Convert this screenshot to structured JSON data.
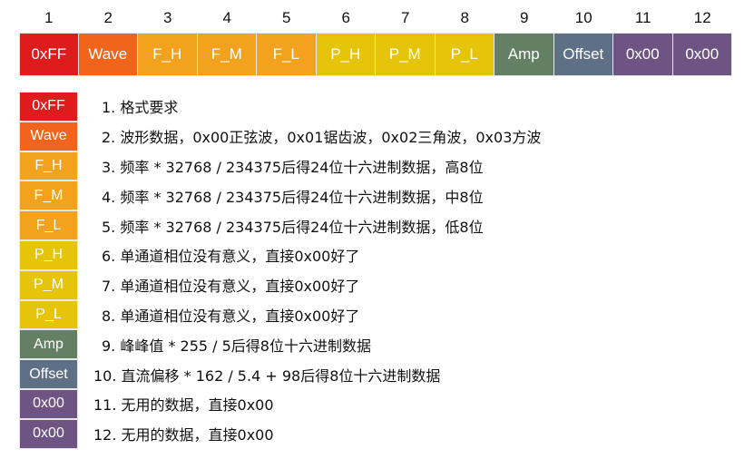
{
  "index_labels": [
    "1",
    "2",
    "3",
    "4",
    "5",
    "6",
    "7",
    "8",
    "9",
    "10",
    "11",
    "12"
  ],
  "cells": [
    {
      "label": "0xFF",
      "color": "#e01b1b"
    },
    {
      "label": "Wave",
      "color": "#f2641c"
    },
    {
      "label": "F_H",
      "color": "#f2a21c"
    },
    {
      "label": "F_M",
      "color": "#f2a21c"
    },
    {
      "label": "F_L",
      "color": "#f2a21c"
    },
    {
      "label": "P_H",
      "color": "#e5c40a"
    },
    {
      "label": "P_M",
      "color": "#e5c40a"
    },
    {
      "label": "P_L",
      "color": "#e5c40a"
    },
    {
      "label": "Amp",
      "color": "#648064"
    },
    {
      "label": "Offset",
      "color": "#5d7086"
    },
    {
      "label": "0x00",
      "color": "#6e5482"
    },
    {
      "label": "0x00",
      "color": "#6e5482"
    }
  ],
  "descriptions": [
    "1. 格式要求",
    "2. 波形数据，0x00正弦波，0x01锯齿波，0x02三角波，0x03方波",
    "3. 频率 * 32768 / 234375后得24位十六进制数据，高8位",
    "4. 频率 * 32768 / 234375后得24位十六进制数据，中8位",
    "5. 频率 * 32768 / 234375后得24位十六进制数据，低8位",
    "6. 单通道相位没有意义，直接0x00好了",
    "7. 单通道相位没有意义，直接0x00好了",
    "8. 单通道相位没有意义，直接0x00好了",
    "9. 峰峰值 * 255 / 5后得8位十六进制数据",
    "10. 直流偏移 * 162 / 5.4 + 98后得8位十六进制数据",
    "11. 无用的数据，直接0x00",
    "12. 无用的数据，直接0x00"
  ]
}
